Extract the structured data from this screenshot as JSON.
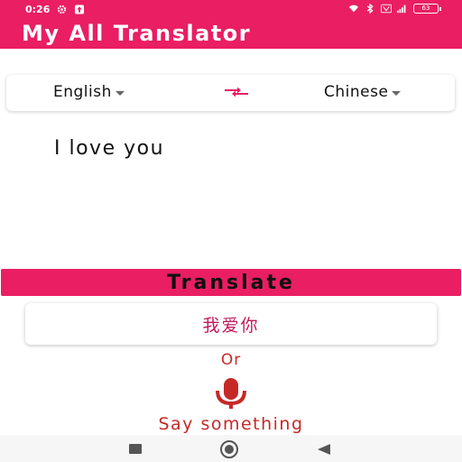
{
  "status_bar": {
    "time": "0:26",
    "battery": "63"
  },
  "app_bar": {
    "title": "My All Translator"
  },
  "language": {
    "source": "English",
    "target": "Chinese"
  },
  "input": {
    "text": "I love you"
  },
  "translate_button": {
    "label": "Translate"
  },
  "result": {
    "text": "我爱你"
  },
  "voice": {
    "or_label": "Or",
    "say_label": "Say something"
  },
  "colors": {
    "primary": "#e91e63",
    "accent_text": "#c62828",
    "result_text": "#c2185b"
  },
  "icons": {
    "swap": "swap-arrows-icon",
    "mic": "microphone-icon"
  }
}
